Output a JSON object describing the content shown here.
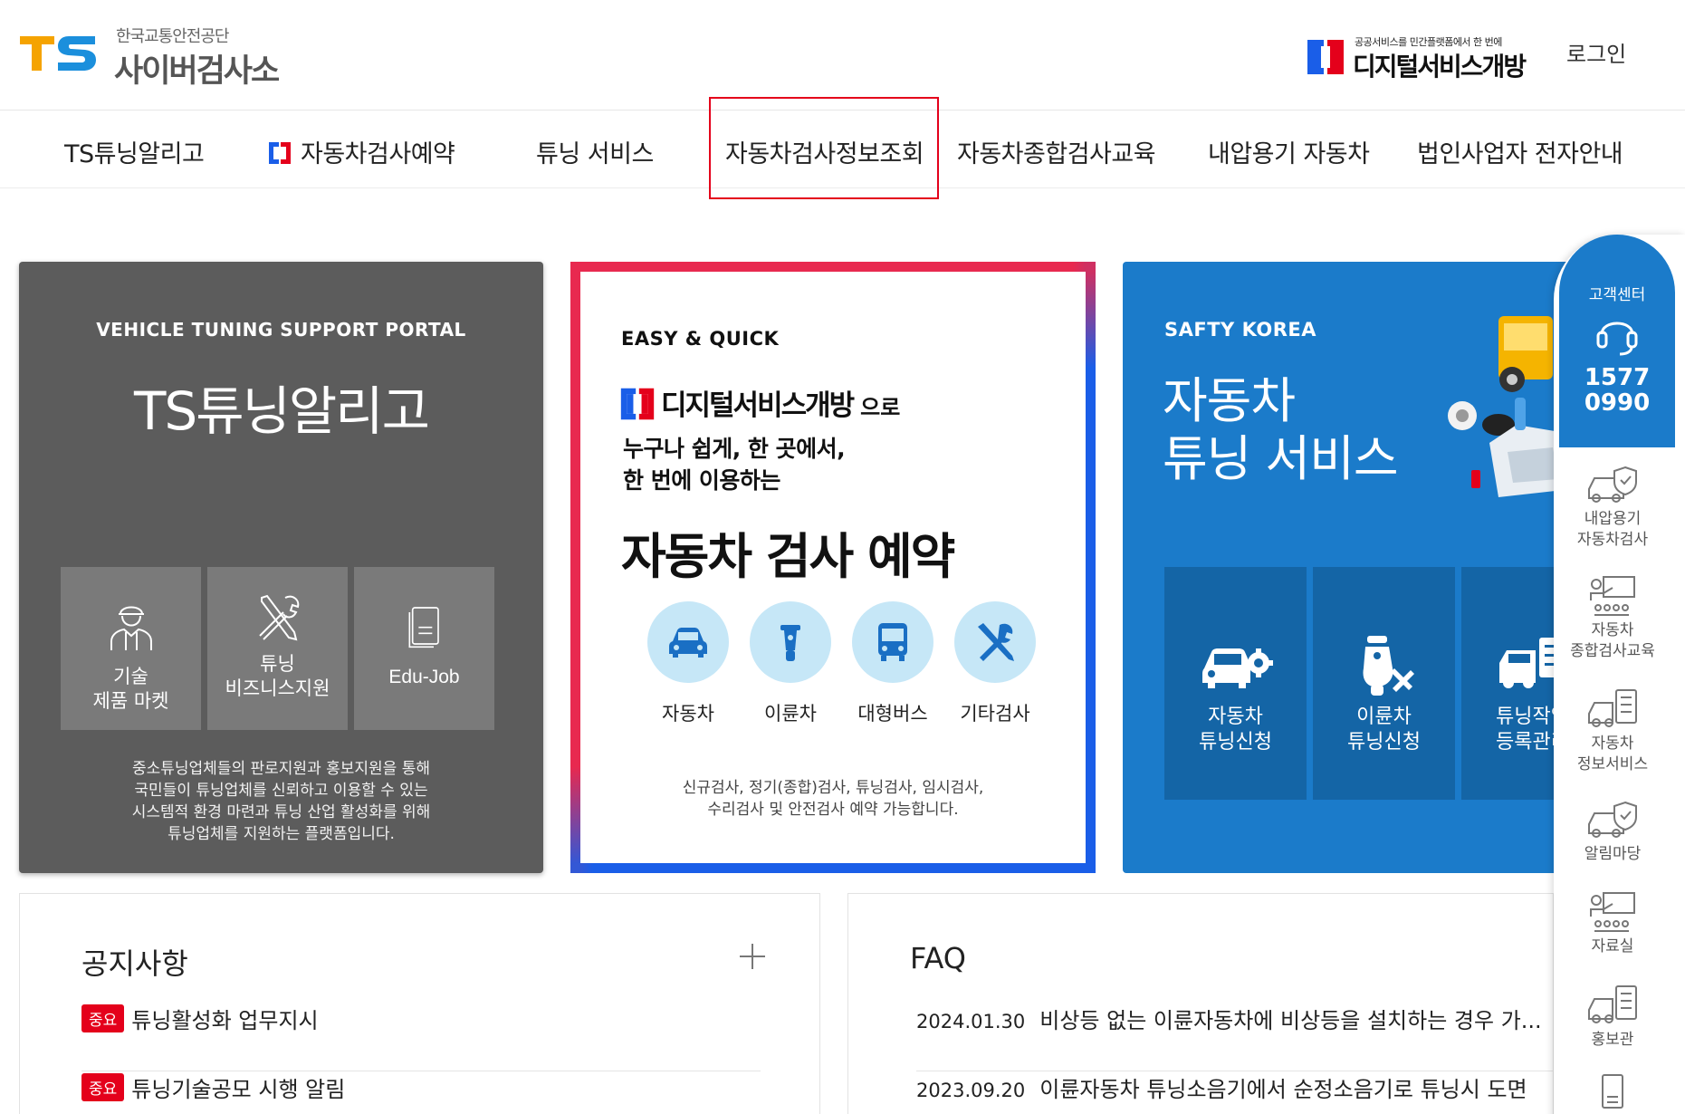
{
  "header": {
    "logo_mark": "TS",
    "logo_sub": "한국교통안전공단",
    "logo_title": "사이버검사소",
    "dsg_sub": "공공서비스를 민간플랫폼에서 한 번에",
    "dsg_name": "디지털서비스개방",
    "login": "로그인"
  },
  "nav": {
    "items": [
      {
        "label": "TS튜닝알리고"
      },
      {
        "label": "자동차검사예약"
      },
      {
        "label": "튜닝 서비스"
      },
      {
        "label": "자동차검사정보조회"
      },
      {
        "label": "자동차종합검사교육"
      },
      {
        "label": "내압용기 자동차"
      },
      {
        "label": "법인사업자 전자안내"
      }
    ]
  },
  "card_tuning": {
    "kicker": "VEHICLE TUNING SUPPORT PORTAL",
    "title": "TS튜닝알리고",
    "tiles": [
      {
        "label": "기술\n제품 마켓",
        "icon": "mechanic-icon"
      },
      {
        "label": "튜닝\n비즈니스지원",
        "icon": "tools-icon"
      },
      {
        "label": "Edu-Job",
        "icon": "document-icon"
      }
    ],
    "desc": "중소튜닝업체들의 판로지원과 홍보지원을 통해\n국민들이 튜닝업체를 신뢰하고 이용할 수 있는\n시스템적 환경 마련과 튜닝 산업 활성화를 위해\n튜닝업체를 지원하는 플랫폼입니다."
  },
  "card_reservation": {
    "kicker": "EASY & QUICK",
    "brand": "디지털서비스개방",
    "brand_suffix": "으로",
    "lead": "누구나 쉽게, 한 곳에서,\n한 번에 이용하는",
    "title": "자동차 검사 예약",
    "icons": [
      {
        "label": "자동차",
        "icon": "car-icon"
      },
      {
        "label": "이륜차",
        "icon": "motorcycle-icon"
      },
      {
        "label": "대형버스",
        "icon": "bus-icon"
      },
      {
        "label": "기타검사",
        "icon": "tools-icon"
      }
    ],
    "note": "신규검사, 정기(종합)검사, 튜닝검사, 임시검사,\n수리검사 및 안전검사 예약 가능합니다."
  },
  "card_service": {
    "kicker": "SAFTY KOREA",
    "title": "자동차\n튜닝 서비스",
    "tiles": [
      {
        "label": "자동차\n튜닝신청",
        "icon": "car-gear-icon"
      },
      {
        "label": "이륜차\n튜닝신청",
        "icon": "scooter-tools-icon"
      },
      {
        "label": "튜닝작업\n등록관리",
        "icon": "truck-checklist-icon"
      }
    ]
  },
  "notice": {
    "title": "공지사항",
    "important_tag": "중요",
    "rows": [
      {
        "tag": "중요",
        "text": "튜닝활성화 업무지시"
      },
      {
        "tag": "중요",
        "text": "튜닝기술공모 시행 알림"
      }
    ]
  },
  "faq": {
    "title": "FAQ",
    "rows": [
      {
        "date": "2024.01.30",
        "text": "비상등 없는 이륜자동차에 비상등을 설치하는 경우 가..."
      },
      {
        "date": "2023.09.20",
        "text": "이륜자동차 튜닝소음기에서 순정소음기로 튜닝시 도면"
      }
    ]
  },
  "quickbar": {
    "cs_title": "고객센터",
    "cs_number": "1577\n0990",
    "items": [
      {
        "label": "내압용기\n자동차검사",
        "icon": "car-shield-icon"
      },
      {
        "label": "자동차\n종합검사교육",
        "icon": "classroom-icon"
      },
      {
        "label": "자동차\n정보서비스",
        "icon": "car-checklist-icon"
      },
      {
        "label": "알림마당",
        "icon": "car-shield-icon"
      },
      {
        "label": "자료실",
        "icon": "classroom-icon"
      },
      {
        "label": "홍보관",
        "icon": "car-checklist-icon"
      }
    ]
  },
  "colors": {
    "accent_blue": "#1b7bca",
    "brand_red": "#e4001b",
    "card_gray": "#5c5c5c",
    "tile_gray": "#7a7a7a",
    "icon_circle": "#c6e7f7"
  }
}
